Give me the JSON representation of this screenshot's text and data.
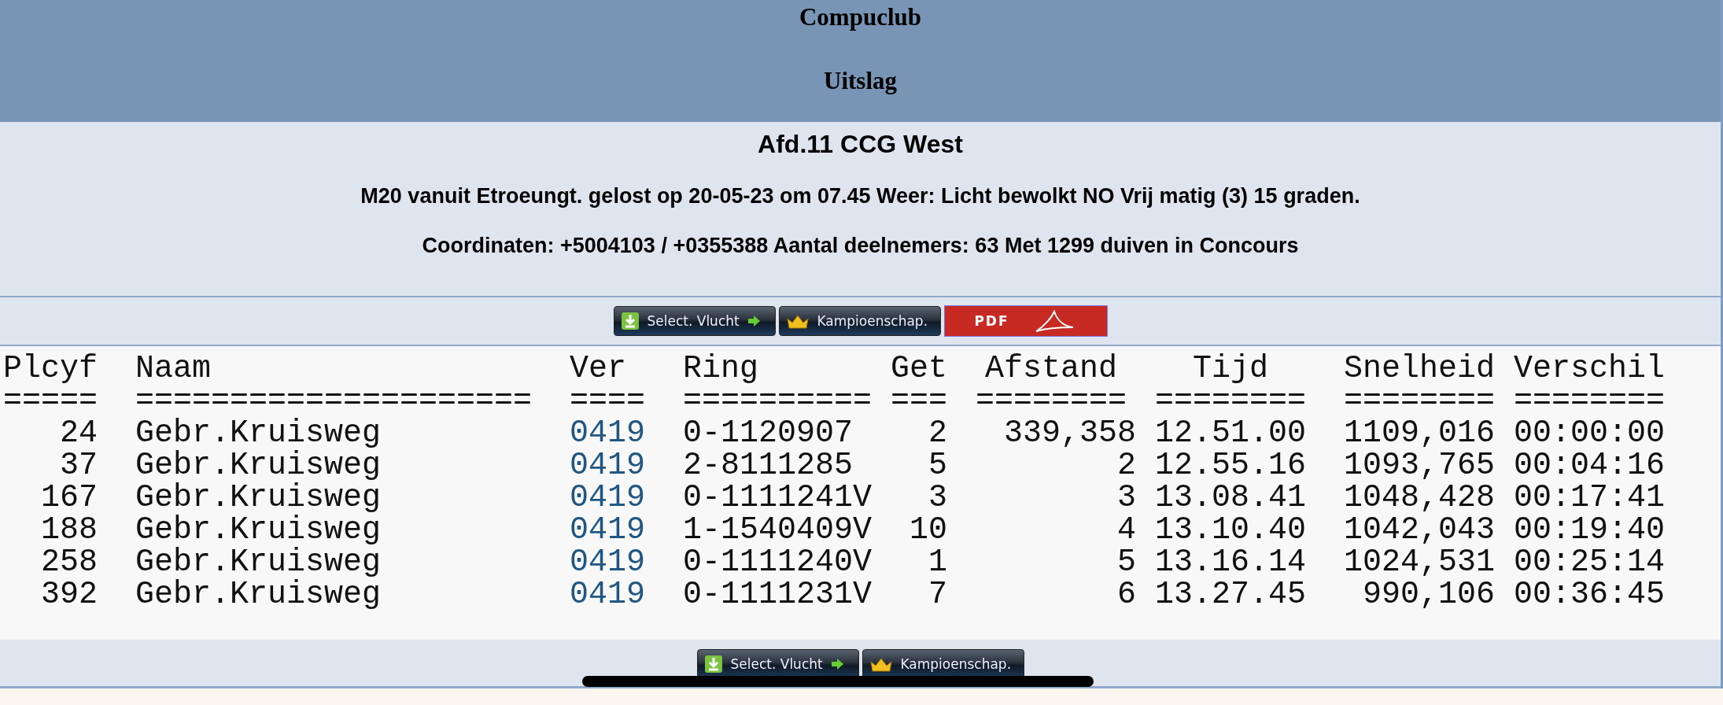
{
  "header": {
    "site_title": "Compuclub",
    "page_title": "Uitslag"
  },
  "info": {
    "heading": "Afd.11 CCG West",
    "flight": "M20 vanuit Etroeungt. gelost op 20-05-23 om 07.45 Weer: Licht bewolkt NO Vrij matig (3) 15 graden.",
    "coordinates": "Coordinaten: +5004103 / +0355388 Aantal deelnemers: 63 Met 1299 duiven in Concours"
  },
  "toolbar": [
    {
      "kind": "select",
      "label": "Select. Vlucht"
    },
    {
      "kind": "championship",
      "label": "Kampioenschap."
    },
    {
      "kind": "pdf",
      "label": "PDF"
    }
  ],
  "table": {
    "columns": [
      {
        "label": "Plcyf",
        "rule": "====="
      },
      {
        "label": "Naam",
        "rule": "====================="
      },
      {
        "label": "Ver",
        "rule": "===="
      },
      {
        "label": "Ring",
        "rule": "=========="
      },
      {
        "label": "Get",
        "rule": "==="
      },
      {
        "label": "Afstand",
        "rule": "========"
      },
      {
        "label": "Tijd",
        "rule": "========"
      },
      {
        "label": "Snelheid",
        "rule": "========"
      },
      {
        "label": "Verschil",
        "rule": "========"
      }
    ],
    "rows": [
      [
        "24",
        "Gebr.Kruisweg",
        "0419",
        "0-1120907",
        "2",
        "339,358",
        "12.51.00",
        "1109,016",
        "00:00:00"
      ],
      [
        "37",
        "Gebr.Kruisweg",
        "0419",
        "2-8111285",
        "5",
        "2",
        "12.55.16",
        "1093,765",
        "00:04:16"
      ],
      [
        "167",
        "Gebr.Kruisweg",
        "0419",
        "0-1111241V",
        "3",
        "3",
        "13.08.41",
        "1048,428",
        "00:17:41"
      ],
      [
        "188",
        "Gebr.Kruisweg",
        "0419",
        "1-1540409V",
        "10",
        "4",
        "13.10.40",
        "1042,043",
        "00:19:40"
      ],
      [
        "258",
        "Gebr.Kruisweg",
        "0419",
        "0-1111240V",
        "1",
        "5",
        "13.16.14",
        "1024,531",
        "00:25:14"
      ],
      [
        "392",
        "Gebr.Kruisweg",
        "0419",
        "0-1111231V",
        "7",
        "6",
        "13.27.45",
        "990,106",
        "00:36:45"
      ]
    ]
  },
  "bottom_toolbar": [
    {
      "kind": "select",
      "label": "Select. Vlucht"
    },
    {
      "kind": "championship",
      "label": "Kampioenschap."
    }
  ]
}
